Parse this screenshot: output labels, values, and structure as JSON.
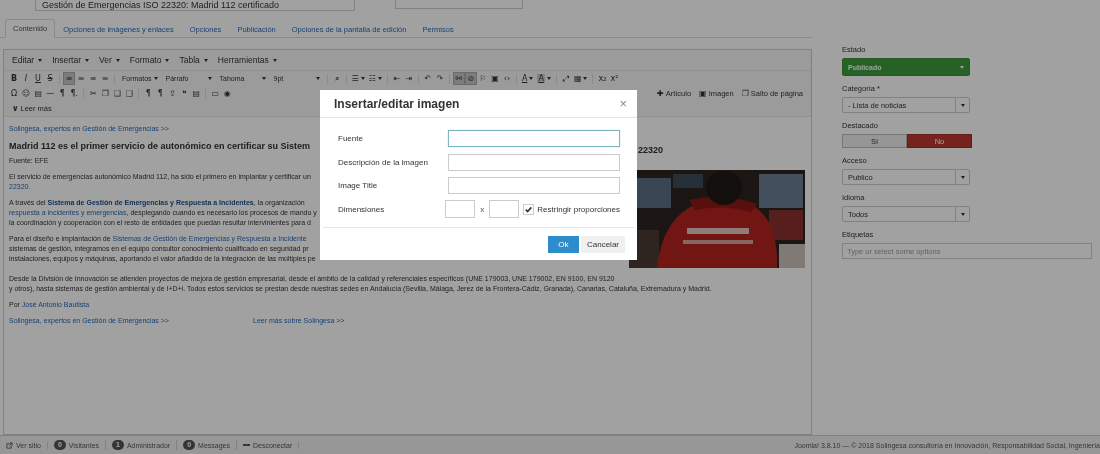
{
  "title_field": {
    "value": "Gestión de Emergencias ISO 22320: Madrid 112 certificado"
  },
  "tabs": [
    {
      "label": "Contenido",
      "selected": true
    },
    {
      "label": "Opciones de imágenes y enlaces",
      "selected": false
    },
    {
      "label": "Opciones",
      "selected": false
    },
    {
      "label": "Publicación",
      "selected": false
    },
    {
      "label": "Opciones de la pantalla de edición",
      "selected": false
    },
    {
      "label": "Permisos",
      "selected": false
    }
  ],
  "editor": {
    "menu": [
      "Editar",
      "Insertar",
      "Ver",
      "Formato",
      "Tabla",
      "Herramientas"
    ],
    "toolbar": [
      {
        "items": [
          {
            "kind": "bold",
            "text": "B",
            "active": false,
            "caret": false
          },
          {
            "kind": "italic",
            "text": "I",
            "active": false,
            "caret": false
          },
          {
            "kind": "underline",
            "text": "U",
            "active": false,
            "caret": false
          },
          {
            "kind": "strike",
            "text": "S",
            "active": false,
            "caret": false
          },
          {
            "kind": "sep"
          },
          {
            "kind": "glyph",
            "text": "≡",
            "active": true,
            "caret": false
          },
          {
            "kind": "glyph",
            "text": "≡",
            "active": false,
            "caret": false
          },
          {
            "kind": "glyph",
            "text": "≡",
            "active": false,
            "caret": false
          },
          {
            "kind": "glyph",
            "text": "≡",
            "active": false,
            "caret": false
          },
          {
            "kind": "sep"
          },
          {
            "kind": "menu",
            "text": "Formatos"
          },
          {
            "kind": "select",
            "text": "Párrafo"
          },
          {
            "kind": "select",
            "text": "Tahoma"
          },
          {
            "kind": "select",
            "text": "9pt"
          },
          {
            "kind": "sep"
          },
          {
            "kind": "glyph",
            "text": "⌕",
            "active": false,
            "caret": false
          },
          {
            "kind": "sep"
          },
          {
            "kind": "glyph",
            "text": "☰",
            "active": false,
            "caret": true
          },
          {
            "kind": "glyph",
            "text": "☷",
            "active": false,
            "caret": true
          },
          {
            "kind": "sep"
          },
          {
            "kind": "glyph",
            "text": "⇤",
            "active": false,
            "caret": false
          },
          {
            "kind": "glyph",
            "text": "⇥",
            "active": false,
            "caret": false
          },
          {
            "kind": "sep"
          },
          {
            "kind": "glyph",
            "text": "↶",
            "active": false,
            "caret": false
          },
          {
            "kind": "glyph",
            "text": "↷",
            "active": false,
            "caret": false
          },
          {
            "kind": "sep"
          },
          {
            "kind": "glyph",
            "text": "⚯",
            "active": true,
            "caret": false
          },
          {
            "kind": "glyph",
            "text": "⊘",
            "active": true,
            "caret": false
          },
          {
            "kind": "glyph",
            "text": "⚐",
            "active": false,
            "caret": false
          },
          {
            "kind": "glyph",
            "text": "▣",
            "active": false,
            "caret": false
          },
          {
            "kind": "glyph",
            "text": "‹›",
            "active": false,
            "caret": false
          },
          {
            "kind": "sep"
          },
          {
            "kind": "underline",
            "text": "A",
            "active": false,
            "caret": true
          },
          {
            "kind": "boxed",
            "text": "A",
            "active": false,
            "caret": true
          },
          {
            "kind": "sep"
          },
          {
            "kind": "glyph",
            "text": "⤢",
            "active": false,
            "caret": false
          },
          {
            "kind": "glyph",
            "text": "▦",
            "active": false,
            "caret": true
          },
          {
            "kind": "sep"
          },
          {
            "kind": "glyph",
            "text": "x₂",
            "active": false,
            "caret": false
          },
          {
            "kind": "glyph",
            "text": "x²",
            "active": false,
            "caret": false
          }
        ]
      },
      {
        "items": [
          {
            "kind": "glyph",
            "text": "Ω",
            "active": false,
            "caret": false
          },
          {
            "kind": "glyph",
            "text": "☺",
            "active": false,
            "caret": false
          },
          {
            "kind": "glyph",
            "text": "▤",
            "active": false,
            "caret": false
          },
          {
            "kind": "glyph",
            "text": "—",
            "active": false,
            "caret": false
          },
          {
            "kind": "glyph",
            "text": "¶",
            "active": false,
            "caret": false
          },
          {
            "kind": "glyph",
            "text": "¶.",
            "active": false,
            "caret": false
          },
          {
            "kind": "sep"
          },
          {
            "kind": "glyph",
            "text": "✂",
            "active": false,
            "caret": false
          },
          {
            "kind": "glyph",
            "text": "❐",
            "active": false,
            "caret": false
          },
          {
            "kind": "glyph",
            "text": "❏",
            "active": false,
            "caret": false
          },
          {
            "kind": "glyph",
            "text": "❑",
            "active": false,
            "caret": false
          },
          {
            "kind": "sep"
          },
          {
            "kind": "glyph",
            "text": "¶",
            "active": false,
            "caret": false
          },
          {
            "kind": "glyph",
            "text": "¶",
            "active": false,
            "caret": false
          },
          {
            "kind": "glyph",
            "text": "⇪",
            "active": false,
            "caret": false
          },
          {
            "kind": "glyph",
            "text": "❝",
            "active": false,
            "caret": false
          },
          {
            "kind": "glyph",
            "text": "▤",
            "active": false,
            "caret": false
          },
          {
            "kind": "sep"
          },
          {
            "kind": "glyph",
            "text": "▭",
            "active": false,
            "caret": false
          },
          {
            "kind": "glyph",
            "text": "◉",
            "active": false,
            "caret": false
          }
        ],
        "right_items": [
          {
            "kind": "label",
            "icon": "✚",
            "text": "Artículo"
          },
          {
            "kind": "label",
            "icon": "▣",
            "text": "Imagen"
          },
          {
            "kind": "label",
            "icon": "❐",
            "text": "Salto de página"
          }
        ]
      },
      {
        "items": [
          {
            "kind": "label",
            "icon": "∨",
            "text": "Leer más"
          }
        ]
      }
    ]
  },
  "content": {
    "upper": [
      {
        "kind": "links",
        "items": [
          "Solingesa, expertos en Gestión de Emergencias >>"
        ]
      },
      {
        "kind": "heading",
        "text": "Madrid 112 es el primer servicio de autonómico en certificar su Sistem"
      },
      {
        "kind": "text",
        "lines": [
          [
            {
              "kind": "plain",
              "text": "Fuente: EFE"
            }
          ]
        ]
      },
      {
        "kind": "text",
        "lines": [
          [
            {
              "kind": "plain",
              "text": "El servicio de emergencias autonómico Madrid 112, ha sido el primero en implantar y certificar un"
            }
          ],
          [
            {
              "kind": "link",
              "text": "22320."
            }
          ]
        ]
      },
      {
        "kind": "text",
        "lines": [
          [
            {
              "kind": "plain",
              "text": "A través del "
            },
            {
              "kind": "strong_link",
              "text": "Sistema de Gestión de Emergencias y Respuesta a Incidentes"
            },
            {
              "kind": "plain",
              "text": ", la organización"
            }
          ],
          [
            {
              "kind": "link",
              "text": "respuesta a incidentes y emergencias"
            },
            {
              "kind": "plain",
              "text": ", desplegando cuando es necesario los procesos de mando y"
            }
          ],
          [
            {
              "kind": "plain",
              "text": "la coordinación y cooperación con el resto de entidades que puedan resultar intervinientes para d"
            }
          ]
        ]
      },
      {
        "kind": "text",
        "lines": [
          [
            {
              "kind": "plain",
              "text": "Para el diseño e implantación de "
            },
            {
              "kind": "link",
              "text": "Sistemas de Gestión de Emergencias y Respuesta a Incidente"
            }
          ],
          [
            {
              "kind": "plain",
              "text": "sistemas de gestión, integramos en el equipo consultor conocimiento cualificado en seguridad pr"
            }
          ],
          [
            {
              "kind": "plain",
              "text": "instalaciones, equipos y máquinas, aportando el valor añadido de la integración de las múltiples pe"
            }
          ]
        ]
      }
    ],
    "heading_end": "22320",
    "lower": [
      {
        "kind": "text",
        "lines": [
          [
            {
              "kind": "plain",
              "text": "Desde la División de Innovación se atienden proyectos de mejora de gestión empresarial, desde el ámbito de la calidad y referenciales específicos (UNE 179003, UNE 179002, EN 9100, EN 9120"
            }
          ],
          [
            {
              "kind": "plain",
              "text": "y otros), hasta sistemas de gestión ambiental y de I+D+i. Todos estos servicios se prestan desde nuestras sedes en Andalucía (Sevilla, Málaga, Jerez de la Frontera-Cádiz, Granada), Canarias, Cataluña, Extremadura y Madrid."
            }
          ]
        ]
      },
      {
        "kind": "text",
        "lines": [
          [
            {
              "kind": "plain",
              "text": "Por "
            },
            {
              "kind": "link",
              "text": "José Antonio Bautista"
            }
          ]
        ]
      },
      {
        "kind": "links",
        "items": [
          "Solingesa, expertos en Gestión de Emergencias >>",
          "Leer más sobre Solingesa >>"
        ]
      }
    ]
  },
  "sidebar": {
    "fields": [
      {
        "kind": "status",
        "label": "Estado",
        "value": "Publicado"
      },
      {
        "kind": "select",
        "label": "Categoría *",
        "value": "- Lista de noticias"
      },
      {
        "kind": "toggle",
        "label": "Destacado",
        "options": [
          {
            "label": "Sí",
            "selected": false
          },
          {
            "label": "No",
            "selected": true
          }
        ]
      },
      {
        "kind": "select",
        "label": "Acceso",
        "value": "Publico"
      },
      {
        "kind": "select",
        "label": "Idioma",
        "value": "Todos"
      },
      {
        "kind": "tags",
        "label": "Etiquetas",
        "placeholder": "Type or select some options"
      }
    ]
  },
  "modal": {
    "title": "Insertar/editar imagen",
    "close": "×",
    "fields": [
      {
        "kind": "text",
        "label": "Fuente",
        "focused": true
      },
      {
        "kind": "text",
        "label": "Descripción de la imagen",
        "focused": false
      },
      {
        "kind": "text",
        "label": "Image Title",
        "focused": false
      },
      {
        "kind": "dimensions",
        "label": "Dimensiones",
        "separator": "x",
        "checkbox": {
          "label": "Restringir proporciones",
          "checked": true
        }
      }
    ],
    "buttons": [
      {
        "label": "Ok",
        "primary": true
      },
      {
        "label": "Cancelar",
        "primary": false
      }
    ]
  },
  "status_bar": {
    "items": [
      {
        "kind": "site",
        "label": "Ver sitio"
      },
      {
        "kind": "count",
        "badge": "0",
        "label": "Visitantes"
      },
      {
        "kind": "count",
        "badge": "1",
        "label": "Administrador"
      },
      {
        "kind": "count",
        "badge": "0",
        "label": "Messages"
      },
      {
        "kind": "logout",
        "label": "Desconectar"
      }
    ],
    "copyright": "Joomla! 3.8.10 — © 2018 Solingesa consultoría en Innovación, Responsabilidad Social, Ingeniería"
  }
}
